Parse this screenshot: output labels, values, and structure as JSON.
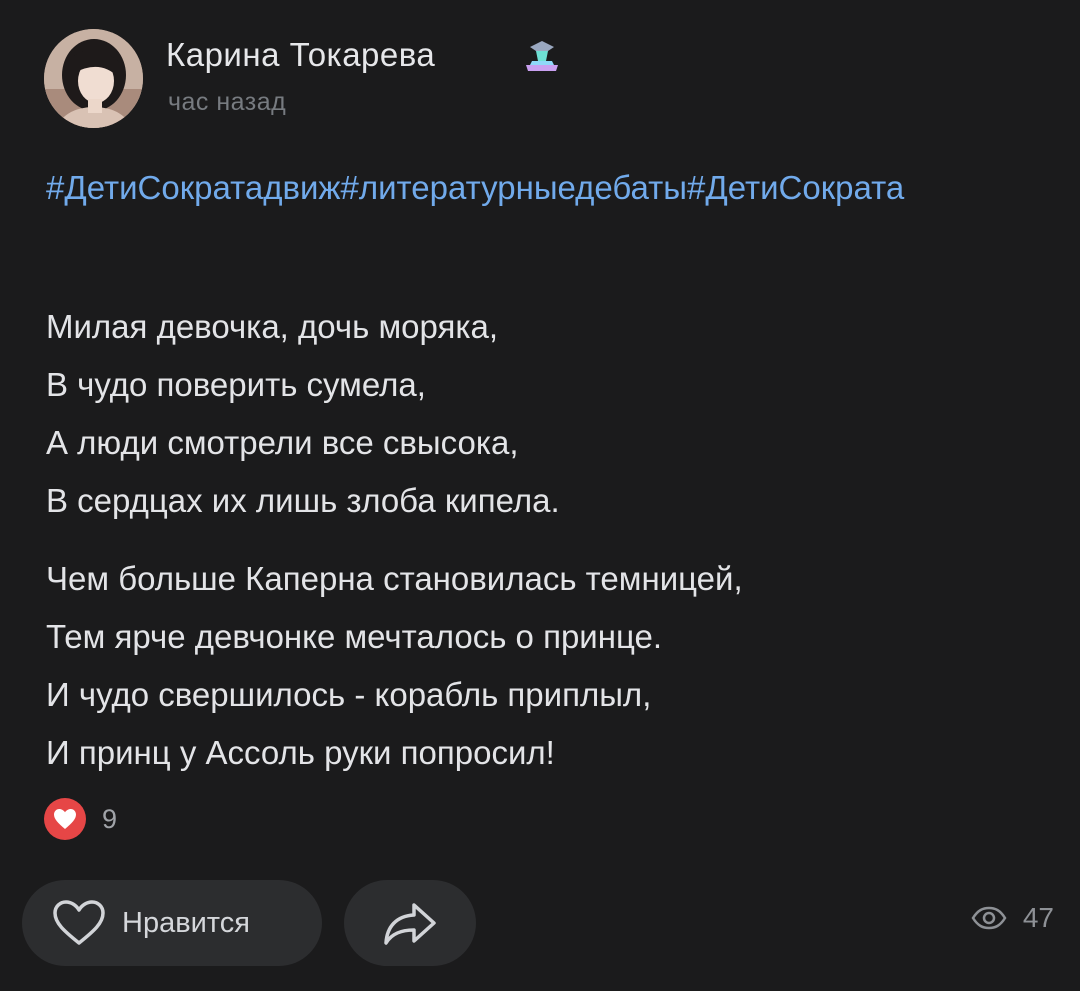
{
  "post": {
    "author_name": "Карина Токарева",
    "time": "час назад",
    "hashtags": "#ДетиСократадвиж#литературныедебаты#ДетиСократа",
    "stanzas": [
      {
        "lines": [
          "Милая девочка, дочь моряка,",
          "В чудо поверить сумела,",
          "А люди смотрели все свысока,",
          "В сердцах их лишь злоба кипела."
        ]
      },
      {
        "lines": [
          "Чем больше Каперна становилась темницей,",
          "Тем ярче девчонке мечталось о принце.",
          "И чудо свершилось - корабль приплыл,",
          "И принц у Ассоль руки попросил!"
        ]
      }
    ]
  },
  "reactions": {
    "icon": "heart-icon",
    "count": "9"
  },
  "actions": {
    "like_label": "Нравится",
    "like_icon": "heart-outline-icon",
    "share_icon": "share-arrow-icon"
  },
  "views": {
    "icon": "eye-icon",
    "count": "47"
  },
  "colors": {
    "background": "#1b1b1c",
    "link": "#71aaeb",
    "reaction": "#e64646",
    "button": "#2c2d2f"
  }
}
